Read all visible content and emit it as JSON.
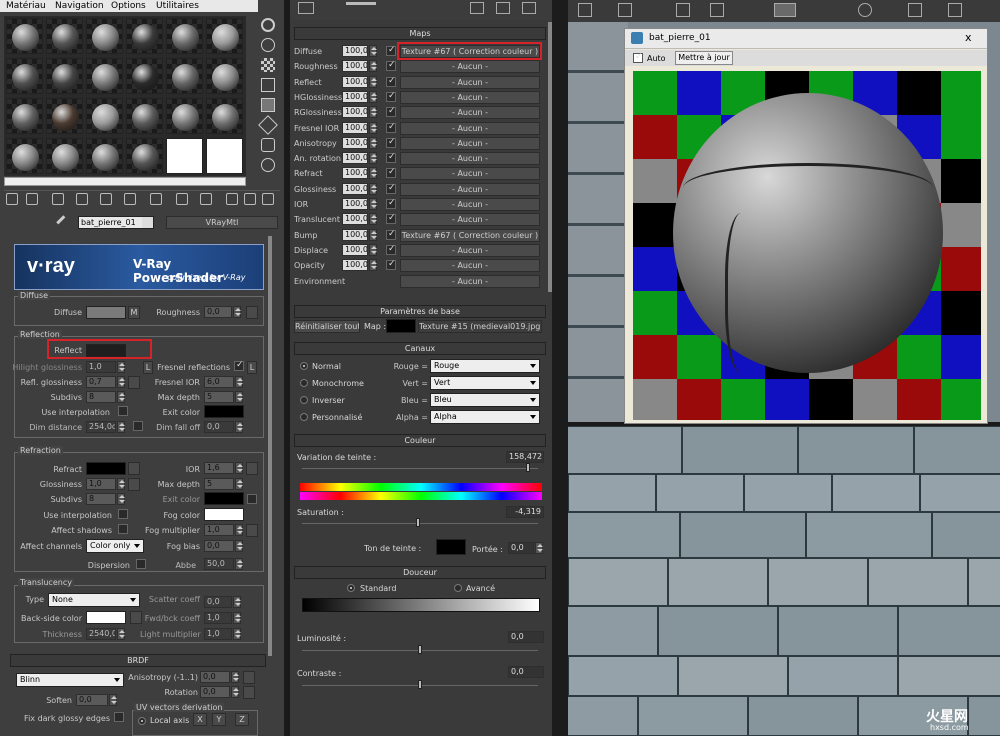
{
  "menubar": {
    "items": [
      "Matériau",
      "Navigation",
      "Options",
      "Utilitaires"
    ]
  },
  "material": {
    "name": "bat_pierre_01",
    "type": "VRayMtl"
  },
  "banner": {
    "logo": "v·ray",
    "title": "V-Ray PowerShader",
    "subtitle": "optimized for V-Ray"
  },
  "diffuse": {
    "section": "Diffuse",
    "diffuse_label": "Diffuse",
    "m_label": "M",
    "roughness_label": "Roughness",
    "roughness_value": "0,0"
  },
  "reflection": {
    "section": "Reflection",
    "reflect_label": "Reflect",
    "hilight_label": "Hilight glossiness",
    "hilight_value": "1,0",
    "l_label": "L",
    "fresnel_label": "Fresnel reflections",
    "fresnel_l": "L",
    "refl_gloss_label": "Refl. glossiness",
    "refl_gloss_value": "0,7",
    "fresnel_ior_label": "Fresnel IOR",
    "fresnel_ior_value": "6,0",
    "subdivs_label": "Subdivs",
    "subdivs_value": "8",
    "maxdepth_label": "Max depth",
    "maxdepth_value": "5",
    "interp_label": "Use interpolation",
    "exit_label": "Exit color",
    "dimdist_label": "Dim distance",
    "dimdist_value": "254,0c",
    "dimfall_label": "Dim fall off",
    "dimfall_value": "0,0"
  },
  "refraction": {
    "section": "Refraction",
    "refract_label": "Refract",
    "ior_label": "IOR",
    "ior_value": "1,6",
    "gloss_label": "Glossiness",
    "gloss_value": "1,0",
    "maxdepth_label": "Max depth",
    "maxdepth_value": "5",
    "subdivs_label": "Subdivs",
    "subdivs_value": "8",
    "exit_label": "Exit color",
    "interp_label": "Use interpolation",
    "fog_label": "Fog color",
    "shadows_label": "Affect shadows",
    "fogmult_label": "Fog multiplier",
    "fogmult_value": "1,0",
    "channels_label": "Affect channels",
    "channels_value": "Color only",
    "fogbias_label": "Fog bias",
    "fogbias_value": "0,0",
    "dispersion_label": "Dispersion",
    "abbe_label": "Abbe",
    "abbe_value": "50,0"
  },
  "translucency": {
    "section": "Translucency",
    "type_label": "Type",
    "type_value": "None",
    "scatter_label": "Scatter coeff",
    "scatter_value": "0,0",
    "backside_label": "Back-side color",
    "fwd_label": "Fwd/bck coeff",
    "fwd_value": "1,0",
    "thickness_label": "Thickness",
    "thickness_value": "2540,0",
    "light_label": "Light multiplier",
    "light_value": "1,0"
  },
  "brdf": {
    "header": "BRDF",
    "type_value": "Blinn",
    "aniso_label": "Anisotropy (-1..1)",
    "aniso_value": "0,0",
    "rotation_label": "Rotation",
    "rotation_value": "0,0",
    "soften_label": "Soften",
    "soften_value": "0,0",
    "uv_label": "UV vectors derivation",
    "fix_label": "Fix dark glossy edges",
    "local_label": "Local axis",
    "x": "X",
    "y": "Y",
    "z": "Z"
  },
  "maps": {
    "header": "Maps",
    "rows": [
      {
        "name": "Diffuse",
        "value": "100,0",
        "map": "Texture #67 ( Correction couleur )"
      },
      {
        "name": "Roughness",
        "value": "100,0",
        "map": "- Aucun -"
      },
      {
        "name": "Reflect",
        "value": "100,0",
        "map": "- Aucun -"
      },
      {
        "name": "HGlossiness",
        "value": "100,0",
        "map": "- Aucun -"
      },
      {
        "name": "RGlossiness",
        "value": "100,0",
        "map": "- Aucun -"
      },
      {
        "name": "Fresnel IOR",
        "value": "100,0",
        "map": "- Aucun -"
      },
      {
        "name": "Anisotropy",
        "value": "100,0",
        "map": "- Aucun -"
      },
      {
        "name": "An. rotation",
        "value": "100,0",
        "map": "- Aucun -"
      },
      {
        "name": "Refract",
        "value": "100,0",
        "map": "- Aucun -"
      },
      {
        "name": "Glossiness",
        "value": "100,0",
        "map": "- Aucun -"
      },
      {
        "name": "IOR",
        "value": "100,0",
        "map": "- Aucun -"
      },
      {
        "name": "Translucent",
        "value": "100,0",
        "map": "- Aucun -"
      },
      {
        "name": "Bump",
        "value": "100,0",
        "map": "Texture #67 ( Correction couleur )"
      },
      {
        "name": "Displace",
        "value": "100,0",
        "map": "- Aucun -"
      },
      {
        "name": "Opacity",
        "value": "100,0",
        "map": "- Aucun -"
      },
      {
        "name": "Environment",
        "value": "",
        "map": "- Aucun -"
      }
    ]
  },
  "base": {
    "header": "Paramètres de base",
    "reset": "Réinitialiser tout",
    "map_label": "Map :",
    "texture": "Texture #15 (medieval019.jpg)"
  },
  "canaux": {
    "header": "Canaux",
    "modes": [
      "Normal",
      "Monochrome",
      "Inverser",
      "Personnalisé"
    ],
    "rouge_label": "Rouge =",
    "rouge_value": "Rouge",
    "vert_label": "Vert =",
    "vert_value": "Vert",
    "bleu_label": "Bleu =",
    "bleu_value": "Bleu",
    "alpha_label": "Alpha =",
    "alpha_value": "Alpha"
  },
  "couleur": {
    "header": "Couleur",
    "hue_label": "Variation de teinte :",
    "hue_value": "158,472",
    "sat_label": "Saturation :",
    "sat_value": "-4,319",
    "tint_label": "Ton de teinte :",
    "portee_label": "Portée :",
    "portee_value": "0,0"
  },
  "douceur": {
    "header": "Douceur",
    "standard": "Standard",
    "avance": "Avancé",
    "lum_label": "Luminosité :",
    "lum_value": "0,0",
    "contrast_label": "Contraste :",
    "contrast_value": "0,0"
  },
  "preview": {
    "title": "bat_pierre_01",
    "close": "x",
    "auto_label": "Auto",
    "fit_label": "Mettre à jour"
  },
  "watermark": {
    "brand": "火星网",
    "url": "hxsd.com"
  },
  "colors": {
    "highlight": "#d6232a",
    "panel": "#444444",
    "banner": "#1e4a8a"
  }
}
